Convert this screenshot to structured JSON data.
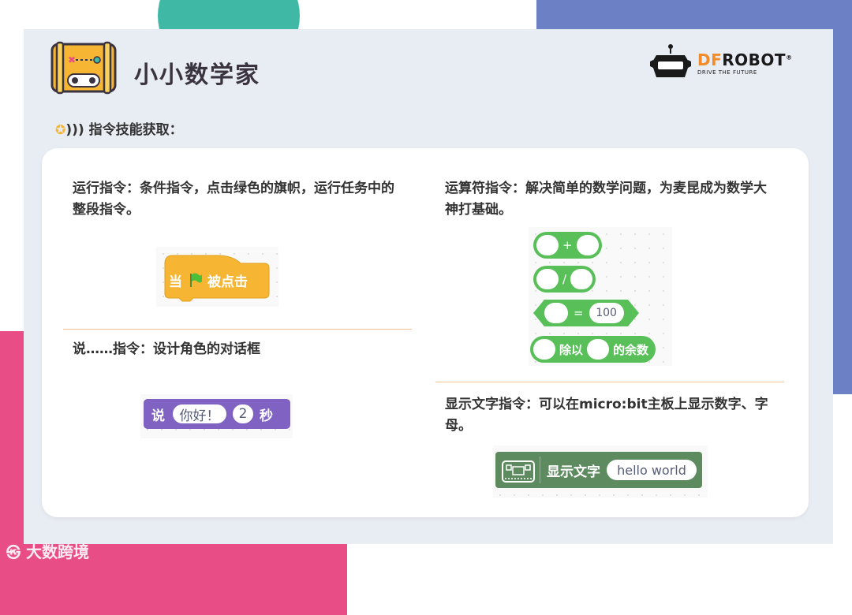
{
  "header": {
    "title": "小小数学家",
    "brand": {
      "prefix": "DF",
      "suffix": "ROBOT",
      "registered": "®",
      "tagline": "DRIVE THE FUTURE"
    }
  },
  "section": {
    "heading": "指令技能获取："
  },
  "cards": {
    "run": {
      "description": "运行指令：条件指令，点击绿色的旗帜，运行任务中的整段指令。",
      "block": {
        "prefix": "当",
        "suffix": "被点击"
      }
    },
    "say": {
      "description": "说……指令：设计角色的对话框",
      "block": {
        "label": "说",
        "text": "你好！",
        "seconds": "2",
        "unit": "秒"
      }
    },
    "operators": {
      "description": "运算符指令：解决简单的数学问题，为麦昆成为数学大神打基础。",
      "add_symbol": "+",
      "divide_symbol": "/",
      "equals_symbol": "=",
      "equals_value": "100",
      "mod_label": "除以",
      "mod_suffix": "的余数"
    },
    "display": {
      "description": "显示文字指令：可以在micro:bit主板上显示数字、字母。",
      "block": {
        "label": "显示文字",
        "text": "hello world"
      }
    }
  },
  "colors": {
    "event_yellow": "#f6b533",
    "looks_purple": "#8062c2",
    "operator_green": "#59c059",
    "display_green": "#5d8a5e",
    "teal": "#3fb8a6",
    "blue": "#6b80c5",
    "pink": "#e94d86"
  },
  "footer": {
    "watermark": "大数跨境"
  }
}
